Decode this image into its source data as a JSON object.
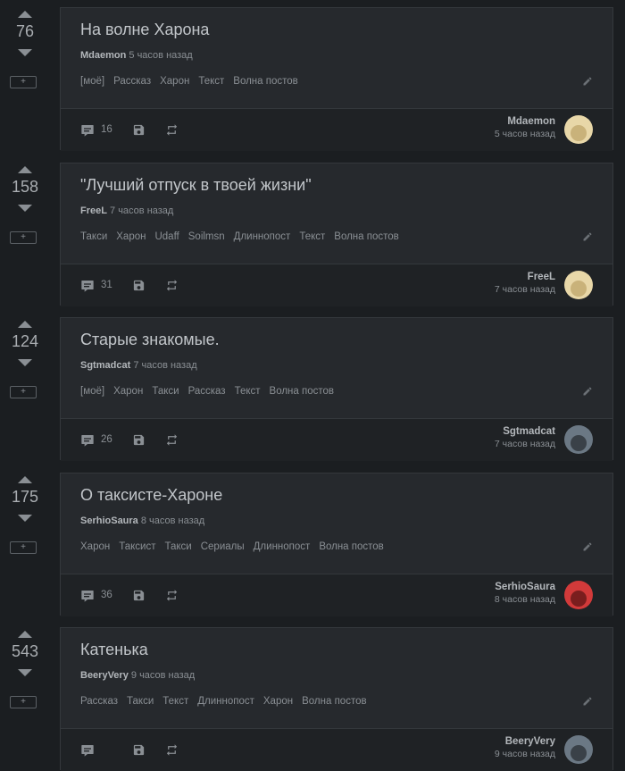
{
  "feed": {
    "stories": [
      {
        "rating": "76",
        "title": "На волне Харона",
        "author": "Mdaemon",
        "time": "5 часов назад",
        "tags": [
          "[моё]",
          "Рассказ",
          "Харон",
          "Текст",
          "Волна постов"
        ],
        "comments": "16",
        "avatar_colors": [
          "#e8d7a8",
          "#c9b27a"
        ]
      },
      {
        "rating": "158",
        "title": "\"Лучший отпуск в твоей жизни\"",
        "author": "FreeL",
        "time": "7 часов назад",
        "tags": [
          "Такси",
          "Харон",
          "Udaff",
          "Soilmsn",
          "Длиннопост",
          "Текст",
          "Волна постов"
        ],
        "comments": "31",
        "avatar_colors": [
          "#e8d7a8",
          "#c9b27a"
        ]
      },
      {
        "rating": "124",
        "title": "Старые знакомые.",
        "author": "Sgtmadcat",
        "time": "7 часов назад",
        "tags": [
          "[моё]",
          "Харон",
          "Такси",
          "Рассказ",
          "Текст",
          "Волна постов"
        ],
        "comments": "26",
        "avatar_colors": [
          "#6b7884",
          "#3a4148"
        ]
      },
      {
        "rating": "175",
        "title": "О таксисте-Хароне",
        "author": "SerhioSaura",
        "time": "8 часов назад",
        "tags": [
          "Харон",
          "Таксист",
          "Такси",
          "Сериалы",
          "Длиннопост",
          "Волна постов"
        ],
        "comments": "36",
        "avatar_colors": [
          "#d23a3a",
          "#7a1e1e"
        ]
      },
      {
        "rating": "543",
        "title": "Катенька",
        "author": "BeeryVery",
        "time": "9 часов назад",
        "tags": [
          "Рассказ",
          "Такси",
          "Текст",
          "Длиннопост",
          "Харон",
          "Волна постов"
        ],
        "comments": "",
        "avatar_colors": [
          "#6b7884",
          "#3a4148"
        ]
      }
    ]
  },
  "ui": {
    "save_plus": "+",
    "icon_color": "#8a8f94",
    "icons": [
      "arrow-up-icon",
      "arrow-down-icon",
      "edit-icon",
      "comments-icon",
      "save-icon",
      "share-icon"
    ]
  }
}
